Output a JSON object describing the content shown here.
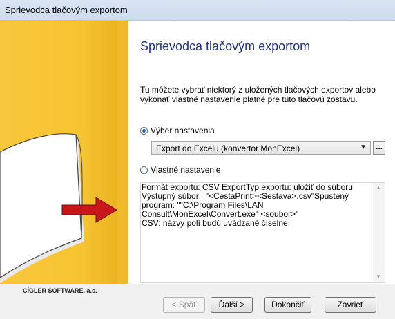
{
  "window": {
    "title": "Sprievodca tlačovým exportom"
  },
  "wizard": {
    "heading": "Sprievodca tlačovým exportom",
    "intro": "Tu môžete vybrať niektorý z uložených tlačových exportov alebo vykonať vlastné nastavenie platné pre túto tlačovú zostavu.",
    "option_saved": {
      "label": "Výber nastavenia",
      "selected": true
    },
    "preset_combo": {
      "value": "Export do Excelu (konvertor MonExcel)"
    },
    "browse_label": "...",
    "option_custom": {
      "label": "Vlastné nastavenie",
      "selected": false
    },
    "details": "Formát exportu: CSV ExportTyp exportu: uložiť do súboru\nVýstupný súbor:  \"<CestaPrint><Sestava>.csv\"Spustený\nprogram: \"\"C:\\Program Files\\LAN\nConsult\\MonExcel\\Convert.exe\" <soubor>\"\nCSV: názvy polí budú uvádzané číselne."
  },
  "footer": {
    "company": "CÍGLER SOFTWARE, a.s.",
    "back_label": "< Späť",
    "next_label": "Ďalší >",
    "finish_label": "Dokončiť",
    "close_label": "Zavrieť"
  },
  "colors": {
    "accent_yellow": "#f7c431",
    "heading_blue": "#1e3287",
    "arrow_red": "#c8161b"
  },
  "icons": [
    "document-page-illustration",
    "red-arrow-icon",
    "chevron-down-icon",
    "scroll-up-icon",
    "scroll-down-icon"
  ]
}
